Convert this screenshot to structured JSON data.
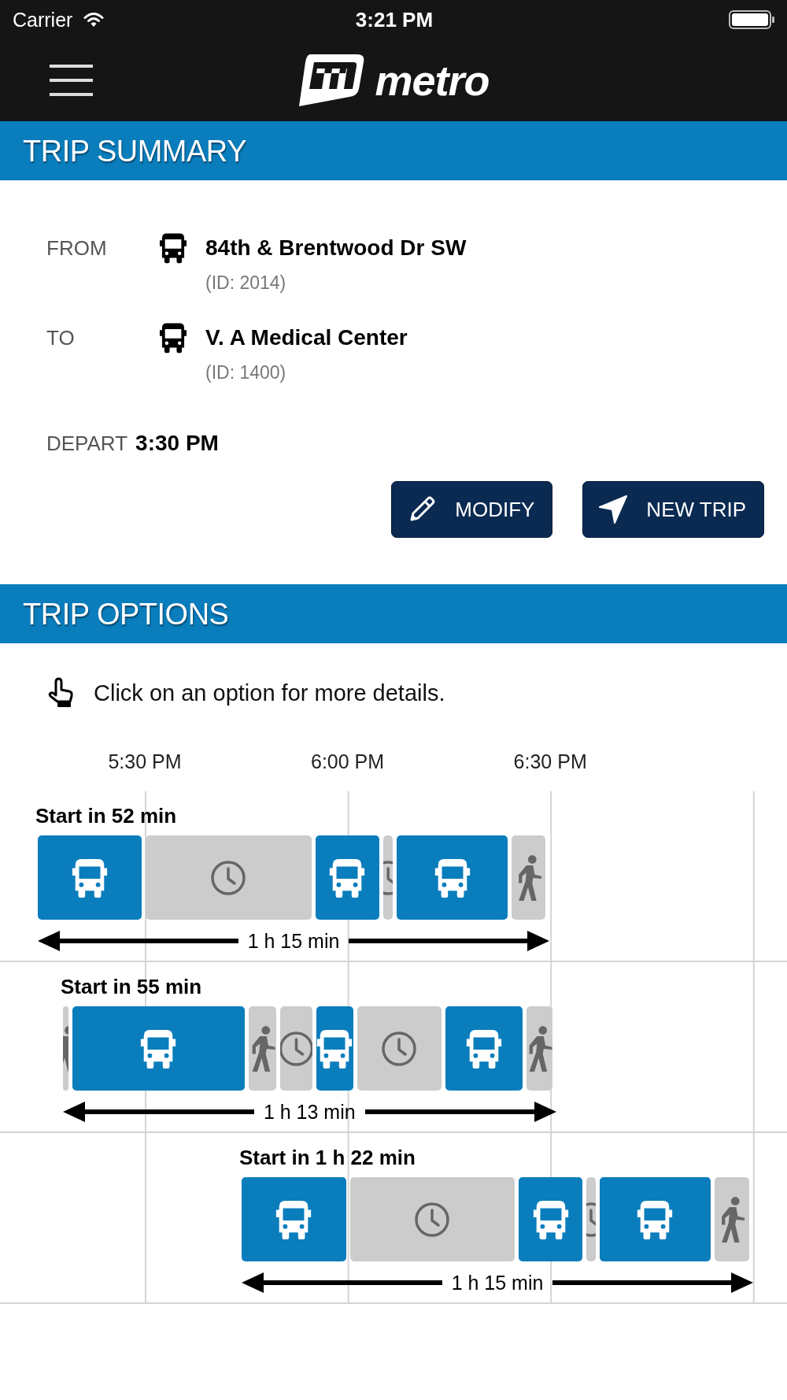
{
  "status_bar": {
    "carrier": "Carrier",
    "time": "3:21 PM"
  },
  "nav_bar": {
    "logo_text": "metro"
  },
  "trip_summary": {
    "title": "TRIP SUMMARY",
    "stops": [
      {
        "label": "FROM",
        "name": "84th & Brentwood Dr SW",
        "stop_id": "(ID: 2014)"
      },
      {
        "label": "TO",
        "name": "V. A Medical Center",
        "stop_id": "(ID: 1400)"
      }
    ],
    "depart": {
      "label": "DEPART",
      "time": "3:30 PM"
    },
    "buttons": [
      {
        "kind": "modify",
        "label": "MODIFY"
      },
      {
        "kind": "new_trip",
        "label": "NEW TRIP"
      }
    ]
  },
  "trip_options": {
    "title": "TRIP OPTIONS",
    "hint": "Click on an option for more details.",
    "ticks": [
      "5:30 PM",
      "6:00 PM",
      "6:30 PM"
    ],
    "options": [
      {
        "title": "Start in 52 min",
        "segments": [
          {
            "kind": "bus"
          },
          {
            "kind": "wait"
          },
          {
            "kind": "bus"
          },
          {
            "kind": "wait"
          },
          {
            "kind": "bus"
          },
          {
            "kind": "walk"
          }
        ],
        "duration": "1 h 15 min"
      },
      {
        "title": "Start in 55 min",
        "segments": [
          {
            "kind": "walk"
          },
          {
            "kind": "bus"
          },
          {
            "kind": "walk"
          },
          {
            "kind": "wait"
          },
          {
            "kind": "bus"
          },
          {
            "kind": "wait"
          },
          {
            "kind": "bus"
          },
          {
            "kind": "walk"
          }
        ],
        "duration": "1 h 13 min"
      },
      {
        "title": "Start in 1 h 22 min",
        "segments": [
          {
            "kind": "bus"
          },
          {
            "kind": "wait"
          },
          {
            "kind": "bus"
          },
          {
            "kind": "wait"
          },
          {
            "kind": "bus"
          },
          {
            "kind": "walk"
          }
        ],
        "duration": "1 h 15 min"
      }
    ]
  }
}
